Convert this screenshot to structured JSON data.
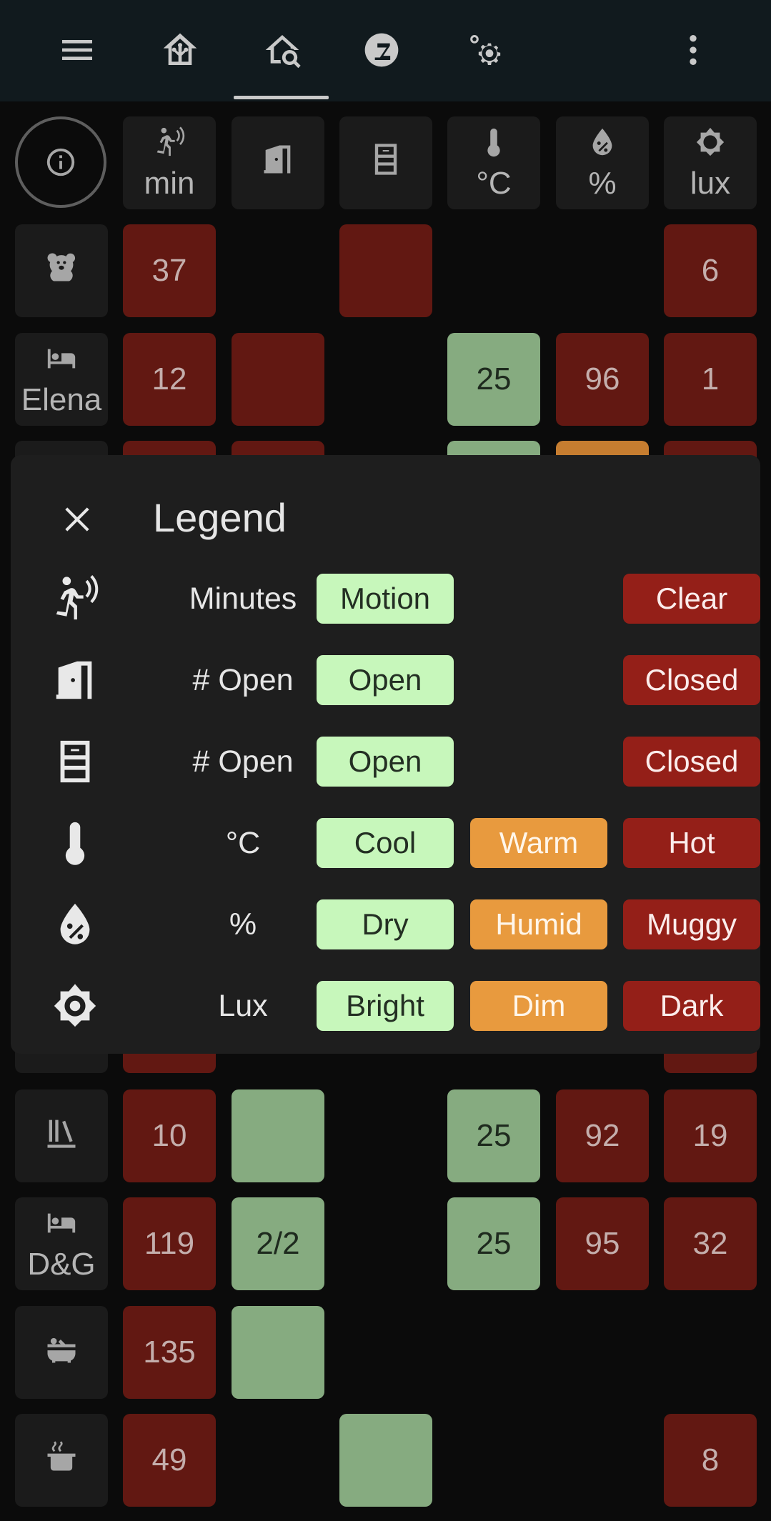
{
  "topbar": {
    "icons": [
      "menu-icon",
      "home-assistant-icon",
      "home-search-icon",
      "zwave-icon",
      "settings-icon",
      "more-vertical-icon"
    ],
    "active_tab": "home-search-icon"
  },
  "grid": {
    "header_units": [
      "min",
      "",
      "",
      "°C",
      "%",
      "lux"
    ],
    "header_icons": [
      "motion-sensor-icon",
      "door-icon",
      "window-icon",
      "thermometer-icon",
      "humidity-icon",
      "brightness-icon"
    ],
    "rooms": [
      {
        "icon": "teddy-bear-icon",
        "label": "",
        "values": [
          "37",
          null,
          "",
          null,
          null,
          "6"
        ]
      },
      {
        "icon": "bed-icon",
        "label": "Elena",
        "values": [
          "12",
          "",
          null,
          "25",
          "96",
          "1"
        ]
      },
      {
        "icon": "library-icon",
        "label": "",
        "values": [
          "10",
          "",
          null,
          "25",
          "92",
          "19"
        ]
      },
      {
        "icon": "bed-icon",
        "label": "D&G",
        "values": [
          "119",
          "2/2",
          null,
          "25",
          "95",
          "32"
        ]
      },
      {
        "icon": "bathtub-icon",
        "label": "",
        "values": [
          "135",
          "",
          null,
          null,
          null,
          null
        ]
      },
      {
        "icon": "pot-steam-icon",
        "label": "",
        "values": [
          "49",
          null,
          "",
          null,
          null,
          "8"
        ]
      }
    ]
  },
  "legend": {
    "title": "Legend",
    "rows": [
      {
        "icon": "motion-sensor-icon",
        "unit": "Minutes",
        "good": "Motion",
        "mid": "",
        "bad": "Clear"
      },
      {
        "icon": "door-icon",
        "unit": "# Open",
        "good": "Open",
        "mid": "",
        "bad": "Closed"
      },
      {
        "icon": "window-icon",
        "unit": "# Open",
        "good": "Open",
        "mid": "",
        "bad": "Closed"
      },
      {
        "icon": "thermometer-icon",
        "unit": "°C",
        "good": "Cool",
        "mid": "Warm",
        "bad": "Hot"
      },
      {
        "icon": "humidity-icon",
        "unit": "%",
        "good": "Dry",
        "mid": "Humid",
        "bad": "Muggy"
      },
      {
        "icon": "brightness-icon",
        "unit": "Lux",
        "good": "Bright",
        "mid": "Dim",
        "bad": "Dark"
      }
    ]
  },
  "colors": {
    "good": "#c7f7bb",
    "mid": "#e89a3e",
    "bad": "#941f18",
    "cell_good": "#86ab80",
    "cell_bad": "#621812"
  }
}
